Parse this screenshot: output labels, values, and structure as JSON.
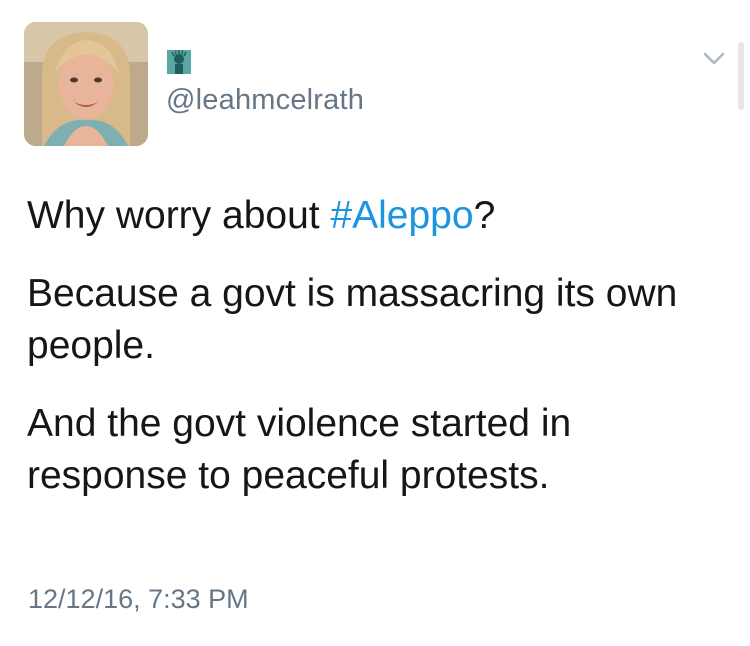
{
  "user": {
    "handle": "@leahmcelrath"
  },
  "tweet": {
    "line1_before": "Why worry about ",
    "line1_hashtag": "#Aleppo",
    "line1_after": "?",
    "paragraph2": "Because a govt is massacring its own people.",
    "paragraph3": "And the govt violence started in response to peaceful protests.",
    "timestamp": "12/12/16, 7:33 PM"
  },
  "colors": {
    "hashtag": "#1b95e0",
    "secondary_text": "#657786",
    "primary_text": "#14171a"
  },
  "icons": {
    "profile_badge": "statue-of-liberty-icon",
    "menu": "chevron-down-icon"
  }
}
